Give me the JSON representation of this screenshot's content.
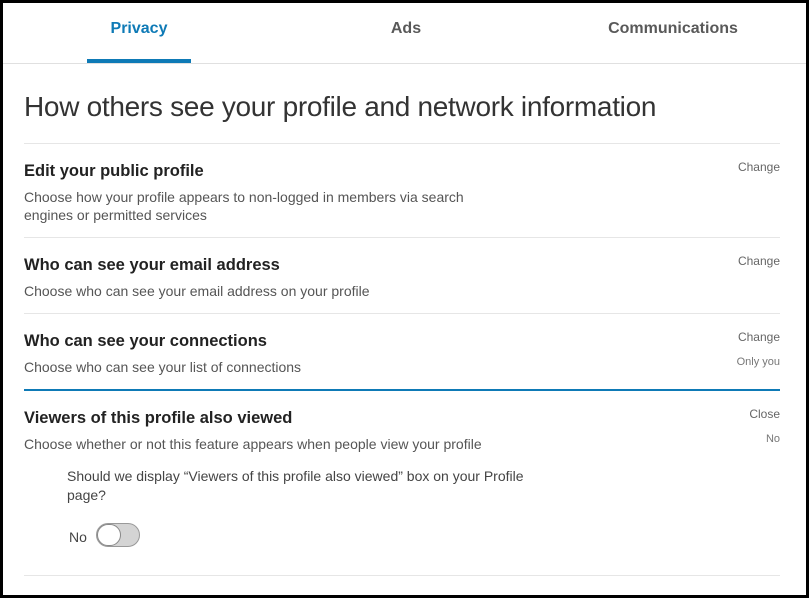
{
  "tabs": [
    {
      "label": "Privacy",
      "active": true
    },
    {
      "label": "Ads",
      "active": false
    },
    {
      "label": "Communications",
      "active": false
    }
  ],
  "heading": "How others see your profile and network information",
  "sections": [
    {
      "title": "Edit your public profile",
      "description": "Choose how your profile appears to non-logged in members via search engines or permitted services",
      "action": "Change"
    },
    {
      "title": "Who can see your email address",
      "description": "Choose who can see your email address on your profile",
      "action": "Change"
    },
    {
      "title": "Who can see your connections",
      "description": "Choose who can see your list of connections",
      "action": "Change",
      "value": "Only you"
    },
    {
      "title": "Viewers of this profile also viewed",
      "description": "Choose whether or not this feature appears when people view your profile",
      "action": "Close",
      "value": "No",
      "question": "Should we display “Viewers of this profile also viewed” box on your Profile page?",
      "toggle": {
        "label": "No",
        "on": false
      }
    }
  ],
  "colors": {
    "accent": "#0e7ab6"
  }
}
